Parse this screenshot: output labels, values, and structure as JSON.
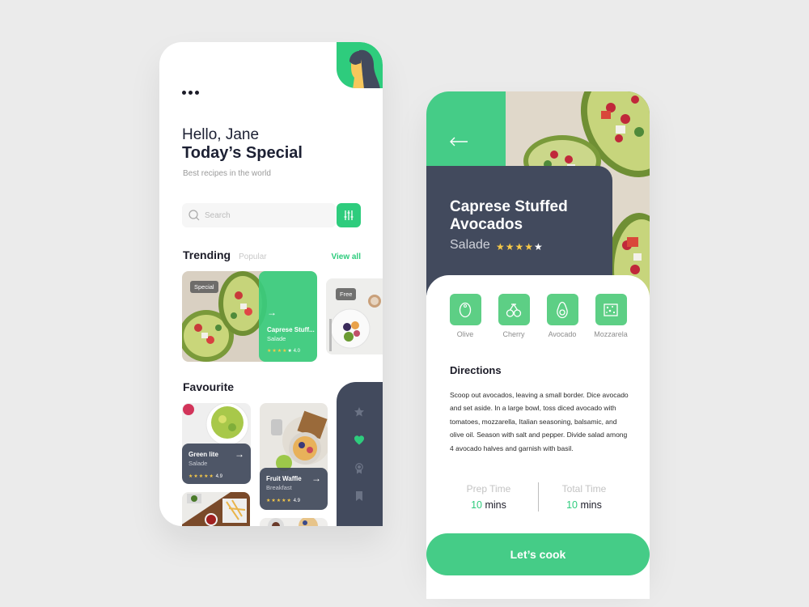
{
  "home": {
    "greeting": "Hello, Jane",
    "headline": "Today’s Special",
    "tagline": "Best recipes in the world",
    "search_placeholder": "Search",
    "trending": {
      "title": "Trending",
      "secondary_tab": "Popular",
      "view_all": "View all",
      "cards": [
        {
          "badge": "Special",
          "name": "Caprese Stuff...",
          "category": "Salade",
          "stars": "★★★★",
          "star_off": "★",
          "rating": "4.0",
          "arrow": "→"
        },
        {
          "badge": "Free"
        }
      ]
    },
    "favourite": {
      "title": "Favourite",
      "cards": [
        {
          "name": "Green lite",
          "category": "Salade",
          "stars": "★★★★★",
          "rating": "4.9",
          "arrow": "→"
        },
        {
          "name": "Fruit Waffle",
          "category": "Breakfast",
          "stars": "★★★★★",
          "rating": "4.9",
          "arrow": "→"
        }
      ]
    },
    "nav": [
      "star",
      "heart",
      "award",
      "bookmark"
    ],
    "active_nav": "heart"
  },
  "detail": {
    "title": "Caprese Stuffed Avocados",
    "category": "Salade",
    "stars_on": "★★★★",
    "stars_off": "★",
    "rating_stars": 4,
    "ingredients": [
      "Olive",
      "Cherry",
      "Avocado",
      "Mozzarela"
    ],
    "directions_title": "Directions",
    "directions": "Scoop out avocados, leaving a small border. Dice avocado and set aside. In a large bowl, toss diced avocado with tomatoes, mozzarella, Italian seasoning, balsamic, and olive oil. Season with salt and pepper. Divide salad among 4 avocado halves and garnish with basil.",
    "prep_label": "Prep Time",
    "prep_value": "10",
    "total_label": "Total Time",
    "total_value": "10",
    "unit": "mins",
    "cta": "Let’s cook"
  },
  "colors": {
    "accent": "#2ecc7d",
    "dark": "#424a5d",
    "star": "#f7c948"
  }
}
